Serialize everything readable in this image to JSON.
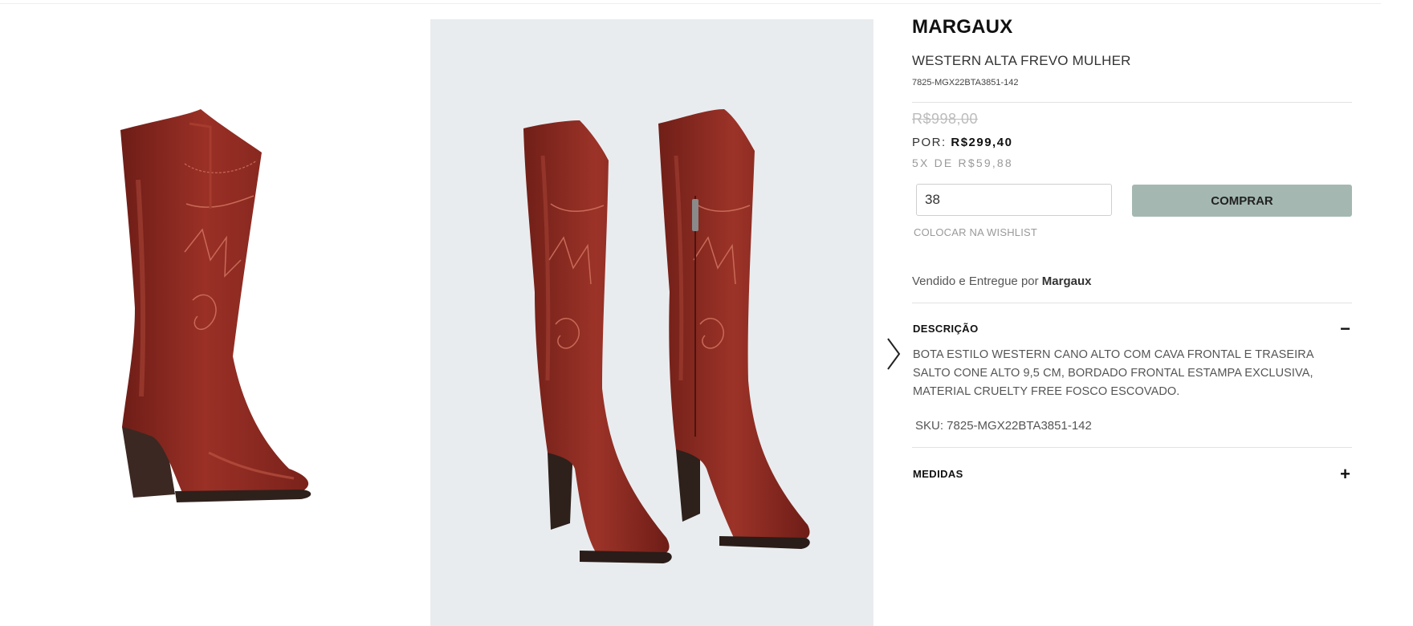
{
  "product": {
    "brand": "MARGAUX",
    "name": "WESTERN ALTA FREVO MULHER",
    "code": "7825-MGX22BTA3851-142"
  },
  "pricing": {
    "old_price": "R$998,00",
    "por_label": "POR:",
    "price": "R$299,40",
    "installments": "5X DE R$59,88"
  },
  "purchase": {
    "size_value": "38",
    "buy_label": "COMPRAR",
    "wishlist_label": "COLOCAR NA WISHLIST"
  },
  "seller": {
    "prefix": "Vendido e Entregue por",
    "name": "Margaux"
  },
  "accordion": {
    "description": {
      "title": "DESCRIÇÃO",
      "icon": "−",
      "body": "BOTA ESTILO WESTERN CANO ALTO COM CAVA FRONTAL E TRASEIRA SALTO CONE ALTO 9,5 CM, BORDADO FRONTAL ESTAMPA EXCLUSIVA, MATERIAL CRUELTY FREE FOSCO ESCOVADO.",
      "sku": "SKU: 7825-MGX22BTA3851-142"
    },
    "measures": {
      "title": "MEDIDAS",
      "icon": "+"
    }
  },
  "colors": {
    "buy_button": "#a4b8b1",
    "boot_leather": "#8e2a22",
    "main_image_bg": "#e9ecef"
  },
  "icons": {
    "gallery_next": "chevron-right-icon",
    "collapse": "minus-icon",
    "expand": "plus-icon"
  }
}
